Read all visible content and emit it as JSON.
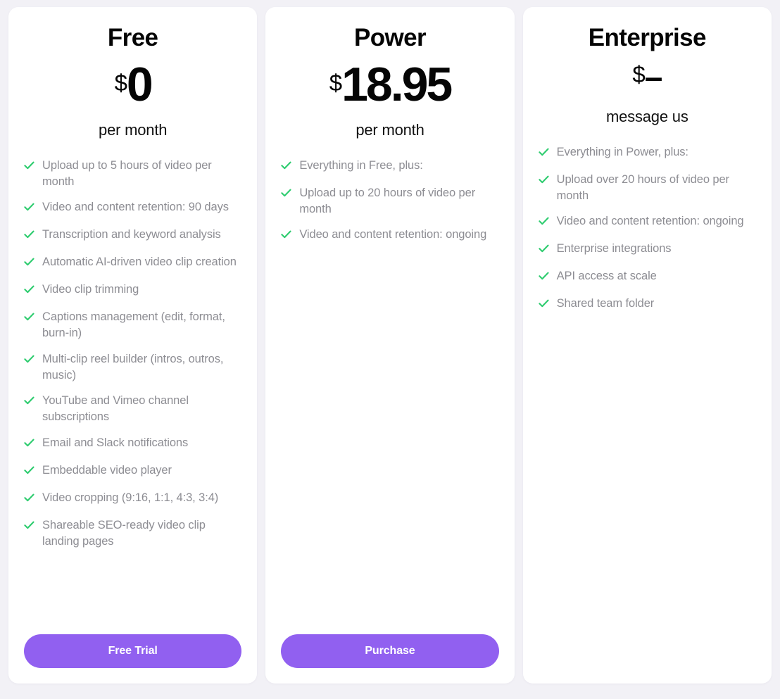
{
  "theme": {
    "page_background": "#f2f1f6",
    "card_background": "#ffffff",
    "accent_purple": "#9160f0",
    "check_green": "#2ecc6f",
    "feature_text_color": "#8d8d93",
    "heading_color": "#050505"
  },
  "plans": [
    {
      "name": "Free",
      "currency": "$",
      "amount": "0",
      "period": "per month",
      "features": [
        "Upload up to 5 hours of video per month",
        "Video and content retention: 90 days",
        "Transcription and keyword analysis",
        "Automatic AI-driven video clip creation",
        "Video clip trimming",
        "Captions management (edit, format, burn-in)",
        "Multi-clip reel builder (intros, outros, music)",
        "YouTube and Vimeo channel subscriptions",
        "Email and Slack notifications",
        "Embeddable video player",
        "Video cropping (9:16, 1:1, 4:3, 3:4)",
        "Shareable SEO-ready video clip landing pages"
      ],
      "cta_label": "Free Trial",
      "has_cta": true
    },
    {
      "name": "Power",
      "currency": "$",
      "amount": "18.95",
      "period": "per month",
      "features": [
        "Everything in Free, plus:",
        "Upload up to 20 hours of video per month",
        "Video and content retention: ongoing"
      ],
      "cta_label": "Purchase",
      "has_cta": true
    },
    {
      "name": "Enterprise",
      "currency": "$",
      "amount": "–",
      "period": "message us",
      "features": [
        "Everything in Power, plus:",
        "Upload over 20 hours of video per month",
        "Video and content retention: ongoing",
        "Enterprise integrations",
        "API access at scale",
        "Shared team folder"
      ],
      "cta_label": "",
      "has_cta": false
    }
  ],
  "icons": {
    "check": "check-icon"
  }
}
